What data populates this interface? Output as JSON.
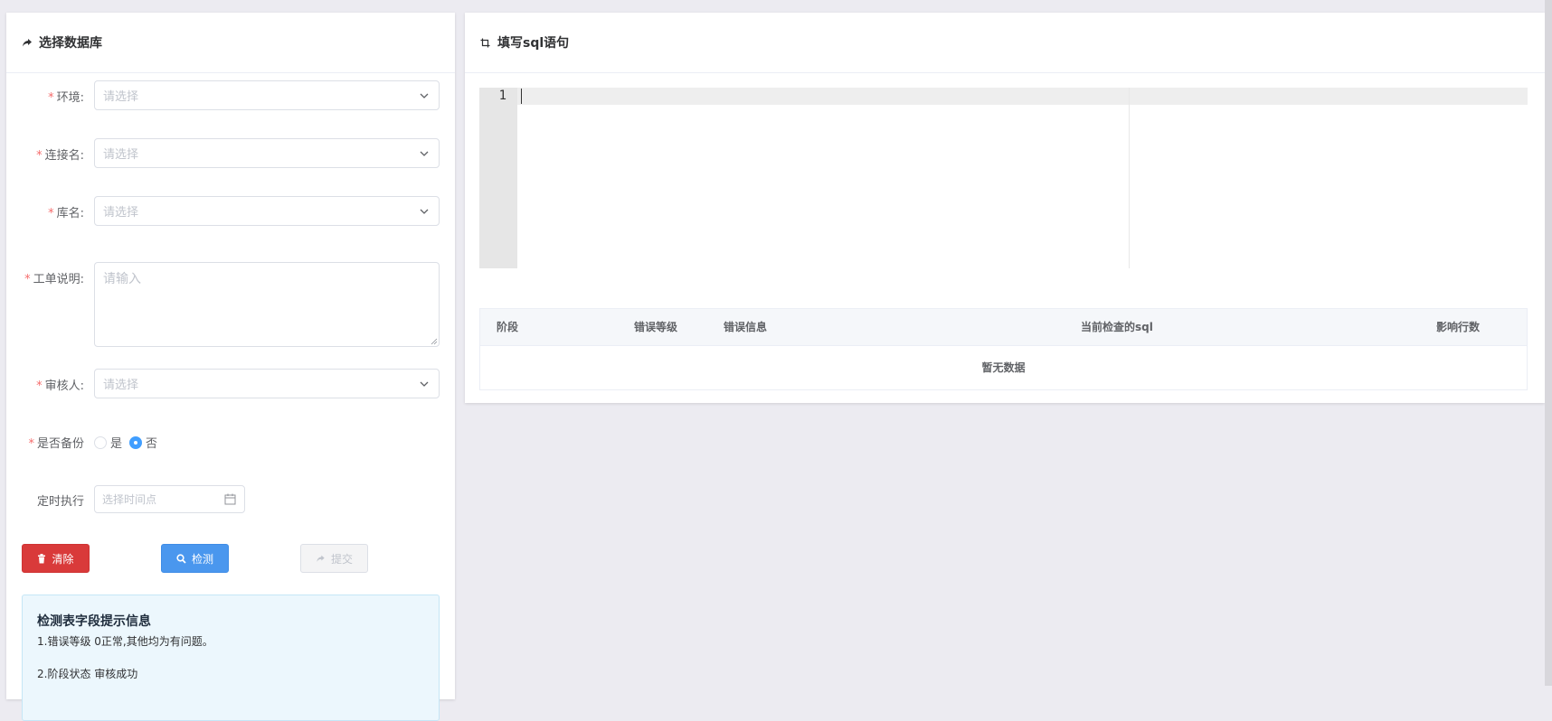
{
  "left_panel": {
    "title": "选择数据库",
    "fields": {
      "env": {
        "label": "环境:",
        "placeholder": "请选择"
      },
      "connection": {
        "label": "连接名:",
        "placeholder": "请选择"
      },
      "database": {
        "label": "库名:",
        "placeholder": "请选择"
      },
      "description": {
        "label": "工单说明:",
        "placeholder": "请输入"
      },
      "reviewer": {
        "label": "审核人:",
        "placeholder": "请选择"
      },
      "backup": {
        "label": "是否备份",
        "options": [
          "是",
          "否"
        ],
        "selected": "否"
      },
      "schedule": {
        "label": "定时执行",
        "placeholder": "选择时间点"
      }
    },
    "buttons": {
      "clear": "清除",
      "check": "检测",
      "submit": "提交"
    },
    "info": {
      "title": "检测表字段提示信息",
      "line1": "1.错误等级 0正常,其他均为有问题。",
      "line2": "2.阶段状态 审核成功"
    }
  },
  "right_panel": {
    "title": "填写sql语句",
    "editor": {
      "line_number": "1"
    },
    "table": {
      "columns": [
        "阶段",
        "错误等级",
        "错误信息",
        "当前检查的sql",
        "影响行数"
      ],
      "empty_text": "暂无数据"
    }
  },
  "colors": {
    "danger": "#d93a3a",
    "primary": "#4a97ee",
    "required": "#f56c6c"
  }
}
